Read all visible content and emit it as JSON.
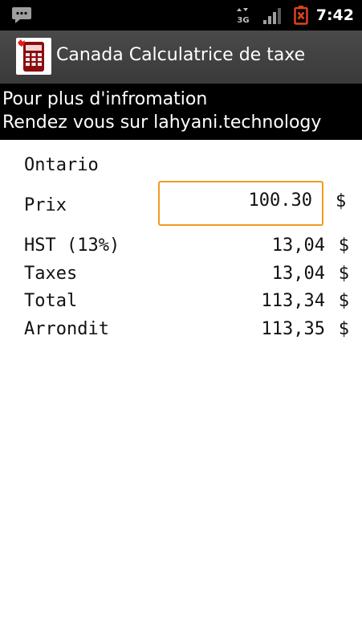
{
  "status_bar": {
    "time": "7:42",
    "icons": [
      "message-icon",
      "3g-data-icon",
      "signal-icon",
      "battery-alert-icon"
    ],
    "network_label": "3G",
    "battery_color": "#e0421b"
  },
  "app": {
    "title": "Canada Calculatrice de taxe",
    "icon": "calculator-icon"
  },
  "banner": {
    "line1": "Pour plus d'infromation",
    "line2": "Rendez vous sur lahyani.technology"
  },
  "form": {
    "province": "Ontario",
    "price_label": "Prix",
    "price_value": "100.30",
    "currency": "$",
    "accent_color": "#f29a23"
  },
  "results": [
    {
      "label": "HST (13%)",
      "value": "13,04",
      "currency": "$"
    },
    {
      "label": "Taxes",
      "value": "13,04",
      "currency": "$"
    },
    {
      "label": "Total",
      "value": "113,34",
      "currency": "$"
    },
    {
      "label": "Arrondit",
      "value": "113,35",
      "currency": "$"
    }
  ]
}
